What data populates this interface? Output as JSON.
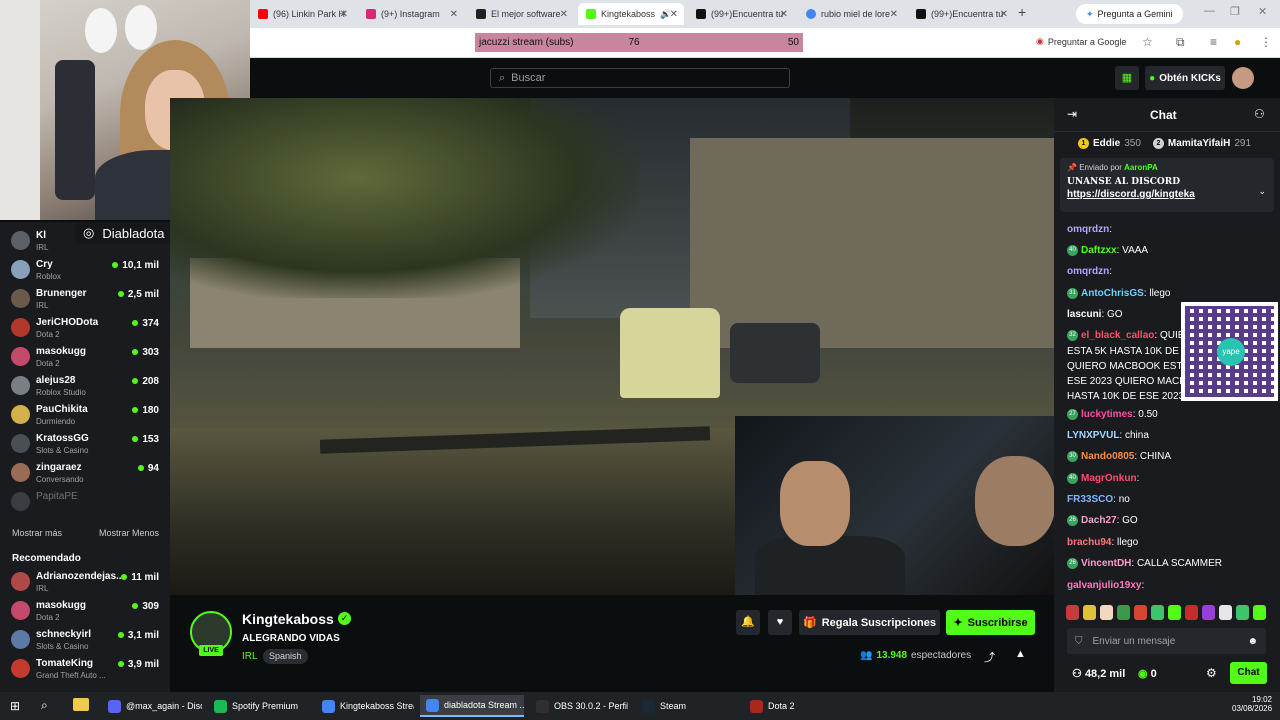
{
  "browser": {
    "tabs": [
      {
        "title": "(96) Linkin Park H",
        "fav_color": "#ff0000"
      },
      {
        "title": "(9+) Instagram",
        "fav_color": "#d62976"
      },
      {
        "title": "El mejor software",
        "fav_color": "#222222"
      },
      {
        "title": "Kingtekaboss",
        "fav_color": "#53fc18"
      },
      {
        "title": "(99+)Encuentra tu",
        "fav_color": "#111111"
      },
      {
        "title": "rubio miel de lore",
        "fav_color": "#4285f4"
      },
      {
        "title": "(99+)Encuentra tu",
        "fav_color": "#111111"
      }
    ],
    "new_tab": "+",
    "gemini_label": "Pregunta a Gemini",
    "translate_label": "Preguntar a Google",
    "extension_bar": {
      "name": "jacuzzi stream (subs)",
      "current": "76",
      "goal": "50"
    }
  },
  "header": {
    "search_placeholder": "Buscar",
    "get_kicks_label": "Obtén KICKs"
  },
  "overlay": {
    "instagram_handle": "Diabladota"
  },
  "sidebar": {
    "following": [
      {
        "name": "Kl",
        "category": "IRL",
        "viewers": "",
        "color": "#5b5f66"
      },
      {
        "name": "Cry",
        "category": "Roblox",
        "viewers": "10,1 mil",
        "color": "#8aa0b8"
      },
      {
        "name": "Brunenger",
        "category": "IRL",
        "viewers": "2,5 mil",
        "color": "#6b5a4a"
      },
      {
        "name": "JeriCHODota",
        "category": "Dota 2",
        "viewers": "374",
        "color": "#b3382c"
      },
      {
        "name": "masokugg",
        "category": "Dota 2",
        "viewers": "303",
        "color": "#c44a6b"
      },
      {
        "name": "alejus28",
        "category": "Roblox Studio",
        "viewers": "208",
        "color": "#7a7f86"
      },
      {
        "name": "PauChikita",
        "category": "Durmiendo",
        "viewers": "180",
        "color": "#d4b04a"
      },
      {
        "name": "KratossGG",
        "category": "Slots & Casino",
        "viewers": "153",
        "color": "#4a4f56"
      },
      {
        "name": "zingaraez",
        "category": "Conversando",
        "viewers": "94",
        "color": "#9a6b55"
      },
      {
        "name": "PapitaPE",
        "category": "",
        "viewers": "",
        "color": "#3a3d41"
      }
    ],
    "show_more": "Mostrar más",
    "show_less": "Mostrar Menos",
    "recommended_title": "Recomendado",
    "recommended": [
      {
        "name": "Adrianozendejas...",
        "category": "IRL",
        "viewers": "11 mil",
        "color": "#b14848"
      },
      {
        "name": "masokugg",
        "category": "Dota 2",
        "viewers": "309",
        "color": "#c44a6b"
      },
      {
        "name": "schneckyirl",
        "category": "Slots & Casino",
        "viewers": "3,1 mil",
        "color": "#5c7aa3"
      },
      {
        "name": "TomateKing",
        "category": "Grand Theft Auto ...",
        "viewers": "3,9 mil",
        "color": "#c33a2f"
      }
    ]
  },
  "stream": {
    "streamer": "Kingtekaboss",
    "live_label": "LIVE",
    "title": "ALEGRANDO VIDAS",
    "category": "IRL",
    "language": "Spanish",
    "gift_label": "Regala Suscripciones",
    "subscribe_label": "Suscribirse",
    "viewer_count": "13.948",
    "viewer_label": "espectadores"
  },
  "chat": {
    "title": "Chat",
    "top_gifters": [
      {
        "rank": "1",
        "name": "Eddie",
        "amount": "350"
      },
      {
        "rank": "2",
        "name": "MamitaYifaiH",
        "amount": "291"
      }
    ],
    "pinned": {
      "sent_by_label": "Enviado por",
      "sent_by": "AaronPA",
      "line1": "UNANSE AL DISCORD",
      "line2": "https://discord.gg/kingteka"
    },
    "qr_label": "yape",
    "messages": [
      {
        "user": "omqrdzn",
        "text": "",
        "color": "#b6a6ff",
        "badge": ""
      },
      {
        "user": "Daftzxx",
        "text": "VAAA",
        "color": "#53fc18",
        "badge": "40"
      },
      {
        "user": "omqrdzn",
        "text": "",
        "color": "#b6a6ff",
        "badge": ""
      },
      {
        "user": "AntoChrisGS",
        "text": "llego",
        "color": "#6fd1ff",
        "badge": "31"
      },
      {
        "user": "lascuni",
        "text": "GO",
        "color": "#ffffff",
        "badge": ""
      },
      {
        "user": "el_black_callao",
        "text": "QUIERO MACBOOK",
        "color": "#ff4f6d",
        "badge": "32"
      },
      {
        "user": "",
        "text": "ESTA 5K HASTA 10K DE ESE 2023",
        "color": "#ffffff",
        "badge": ""
      },
      {
        "user": "",
        "text": "QUIERO MACBOOK ESTA 5K HASTA 10K DE",
        "color": "#ffffff",
        "badge": ""
      },
      {
        "user": "",
        "text": "ESE 2023 QUIERO MACBOOK ESTA 5K",
        "color": "#ffffff",
        "badge": ""
      },
      {
        "user": "",
        "text": "HASTA 10K DE ESE 2023",
        "color": "#ffffff",
        "badge": ""
      },
      {
        "user": "luckytimes",
        "text": "0.50",
        "color": "#ff4fa3",
        "badge": "27"
      },
      {
        "user": "LYNXPVUL",
        "text": "china",
        "color": "#a6d7ff",
        "badge": ""
      },
      {
        "user": "Nando0805",
        "text": "CHINA",
        "color": "#ff8c42",
        "badge": "30"
      },
      {
        "user": "MagrOnkun",
        "text": "",
        "color": "#ff4f6d",
        "badge": "40"
      },
      {
        "user": "FR33SCO",
        "text": "no",
        "color": "#7fb6ff",
        "badge": ""
      },
      {
        "user": "Dach27",
        "text": "GO",
        "color": "#ff9ecb",
        "badge": "26"
      },
      {
        "user": "brachu94",
        "text": "llego",
        "color": "#ff7a7a",
        "badge": ""
      },
      {
        "user": "VincentDH",
        "text": "CALLA SCAMMER",
        "color": "#ff9ecb",
        "badge": "26"
      },
      {
        "user": "galvanjulio19xy",
        "text": "",
        "color": "#ff7ab8",
        "badge": ""
      }
    ],
    "input_placeholder": "Enviar un mensaje",
    "kicks_balance": "48,2 mil",
    "points_balance": "0",
    "send_label": "Chat"
  },
  "taskbar": {
    "apps": [
      {
        "label": "@max_again - Disc...",
        "color": "#5865f2"
      },
      {
        "label": "Spotify Premium",
        "color": "#1db954"
      },
      {
        "label": "Kingtekaboss Strea...",
        "color": "#4285f4"
      },
      {
        "label": "diabladota Stream ...",
        "color": "#4285f4"
      },
      {
        "label": "OBS 30.0.2 - Perfil: ...",
        "color": "#302e31"
      },
      {
        "label": "Steam",
        "color": "#1b2838"
      },
      {
        "label": "Dota 2",
        "color": "#a52a1b"
      }
    ],
    "time": "19:02",
    "date": "03/08/2026"
  }
}
